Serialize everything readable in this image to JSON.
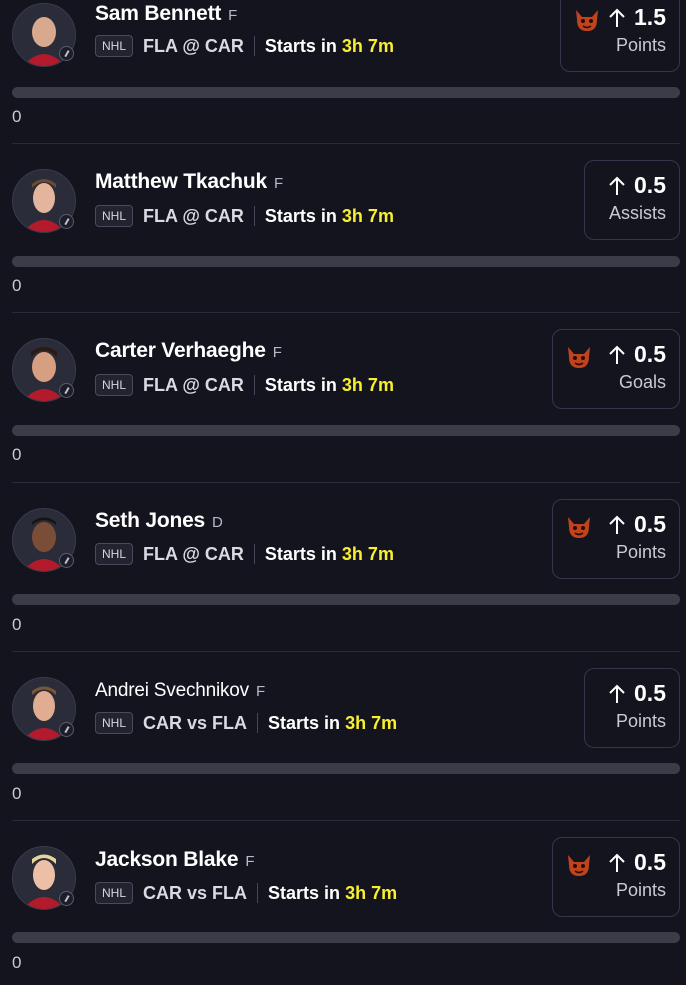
{
  "colors": {
    "background": "#14141f",
    "countdown": "#f7ef2f",
    "bar_track": "#3b3c47",
    "card_border": "#34364a"
  },
  "props": [
    {
      "player": "Sam Bennett",
      "position": "F",
      "league": "NHL",
      "matchup": "FLA @ CAR",
      "starts_prefix": "Starts in",
      "countdown": "3h 7m",
      "line": "1.5",
      "stat": "Points",
      "demon": true,
      "progress_value": "0",
      "progress_fraction": 0
    },
    {
      "player": "Matthew Tkachuk",
      "position": "F",
      "league": "NHL",
      "matchup": "FLA @ CAR",
      "starts_prefix": "Starts in",
      "countdown": "3h 7m",
      "line": "0.5",
      "stat": "Assists",
      "demon": false,
      "progress_value": "0",
      "progress_fraction": 0
    },
    {
      "player": "Carter Verhaeghe",
      "position": "F",
      "league": "NHL",
      "matchup": "FLA @ CAR",
      "starts_prefix": "Starts in",
      "countdown": "3h 7m",
      "line": "0.5",
      "stat": "Goals",
      "demon": true,
      "progress_value": "0",
      "progress_fraction": 0
    },
    {
      "player": "Seth Jones",
      "position": "D",
      "league": "NHL",
      "matchup": "FLA @ CAR",
      "starts_prefix": "Starts in",
      "countdown": "3h 7m",
      "line": "0.5",
      "stat": "Points",
      "demon": true,
      "progress_value": "0",
      "progress_fraction": 0
    },
    {
      "player": "Andrei Svechnikov",
      "position": "F",
      "league": "NHL",
      "matchup": "CAR vs FLA",
      "starts_prefix": "Starts in",
      "countdown": "3h 7m",
      "line": "0.5",
      "stat": "Points",
      "demon": false,
      "progress_value": "0",
      "progress_fraction": 0
    },
    {
      "player": "Jackson Blake",
      "position": "F",
      "league": "NHL",
      "matchup": "CAR vs FLA",
      "starts_prefix": "Starts in",
      "countdown": "3h 7m",
      "line": "0.5",
      "stat": "Points",
      "demon": true,
      "progress_value": "0",
      "progress_fraction": 0
    }
  ],
  "icons": {
    "direction": "arrow-up-icon",
    "modifier": "demon-icon",
    "sport": "hockey-stick-icon"
  }
}
